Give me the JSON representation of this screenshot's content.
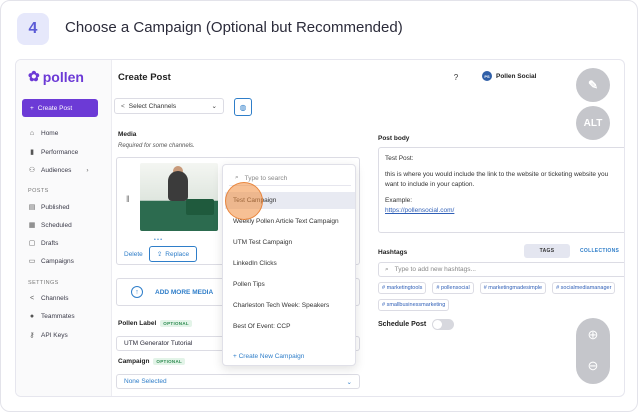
{
  "step": {
    "number": "4",
    "title": "Choose a Campaign (Optional but Recommended)"
  },
  "app": {
    "logo": "pollen",
    "create_post": "Create Post"
  },
  "sidebar": {
    "items": [
      {
        "label": "Home",
        "icon": "home-icon"
      },
      {
        "label": "Performance",
        "icon": "bar-chart-icon"
      },
      {
        "label": "Audiences",
        "icon": "users-icon"
      }
    ],
    "posts_section": "POSTS",
    "posts_items": [
      {
        "label": "Published",
        "icon": "doc-icon"
      },
      {
        "label": "Scheduled",
        "icon": "calendar-icon"
      },
      {
        "label": "Drafts",
        "icon": "draft-icon"
      },
      {
        "label": "Campaigns",
        "icon": "campaign-icon"
      }
    ],
    "settings_section": "SETTINGS",
    "settings_items": [
      {
        "label": "Channels",
        "icon": "share-icon"
      },
      {
        "label": "Teammates",
        "icon": "person-icon"
      },
      {
        "label": "API Keys",
        "icon": "key-icon"
      }
    ]
  },
  "header": {
    "title": "Create Post",
    "help": "?",
    "account_name": "Pollen Social",
    "account_initials": "PS"
  },
  "channels": {
    "placeholder": "Select Channels"
  },
  "media": {
    "label": "Media",
    "sublabel": "Required for some channels.",
    "delete": "Delete",
    "replace": "Replace",
    "add_more": "ADD MORE MEDIA",
    "thumb_dots": "• • •"
  },
  "pollen_label": {
    "label": "Pollen Label",
    "tag": "OPTIONAL",
    "value": "UTM Generator Tutorial"
  },
  "campaign": {
    "label": "Campaign",
    "tag": "OPTIONAL",
    "value": "None Selected"
  },
  "dropdown": {
    "search_placeholder": "Type to search",
    "items": [
      "Test Campaign",
      "Weekly Pollen Article Text Campaign",
      "UTM Test Campaign",
      "LinkedIn Clicks",
      "Pollen Tips",
      "Charleston Tech Week: Speakers",
      "Best Of Event: CCP"
    ],
    "new_campaign": "+ Create New Campaign"
  },
  "post_body": {
    "label": "Post body",
    "line1": "Test Post:",
    "line2": "this is where you would include the link to the website or ticketing website you want to include in your caption.",
    "line3": "Example:",
    "link": "https://pollensocial.com/"
  },
  "hashtags": {
    "label": "Hashtags",
    "tab_tags": "TAGS",
    "tab_collections": "COLLECTIONS",
    "placeholder": "Type to add new hashtags...",
    "chips": [
      "# marketingtools",
      "# pollensocial",
      "# marketingmadesimple",
      "# socialmediamanager",
      "# smallbusinessmarketing"
    ]
  },
  "schedule": {
    "label": "Schedule Post"
  },
  "overlay": {
    "alt": "ALT"
  },
  "colors": {
    "brand": "#6c3ad6",
    "link": "#2f7ec9",
    "highlight": "#f08c3c"
  }
}
